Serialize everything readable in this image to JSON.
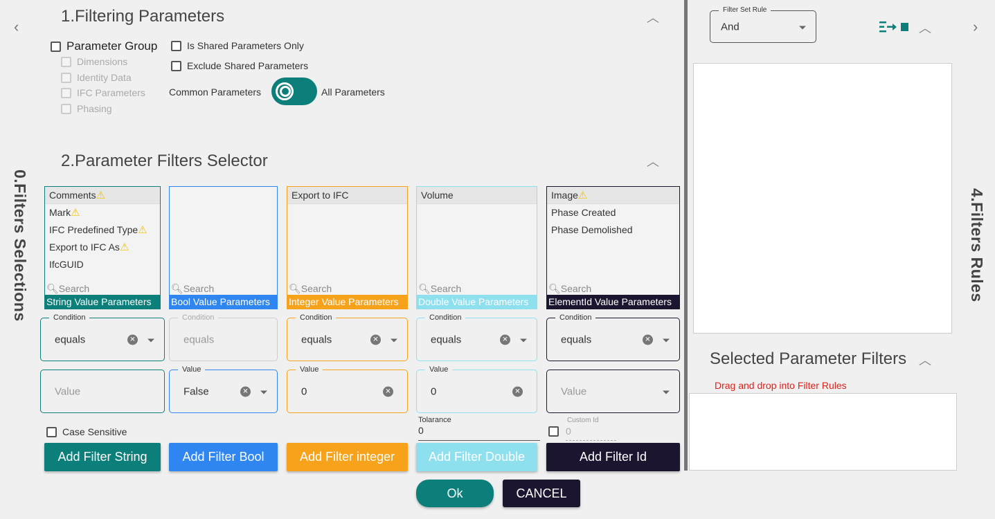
{
  "nav": {
    "left_arrow": "‹",
    "right_arrow": "›"
  },
  "side_labels": {
    "left": "0.Filters Selections",
    "right": "4.Filters Rules"
  },
  "section1": {
    "title": "1.Filtering Parameters",
    "parameter_group": "Parameter Group",
    "groups": [
      "Dimensions",
      "Identity Data",
      "IFC Parameters",
      "Phasing"
    ],
    "shared_only": "Is Shared Parameters Only",
    "exclude_shared": "Exclude Shared Parameters",
    "common": "Common Parameters",
    "all": "All Parameters"
  },
  "section2": {
    "title": "2.Parameter Filters Selector"
  },
  "columns": [
    {
      "items": [
        "Comments",
        "Mark",
        "IFC Predefined Type",
        "Export to IFC As",
        "IfcGUID"
      ],
      "footer": "String Value Parameters",
      "search": "Search",
      "color": "#0d7f7a",
      "condition_label": "Condition",
      "condition": "equals",
      "value_label": "",
      "value": "Value",
      "button": "Add Filter String",
      "extra": "Case Sensitive"
    },
    {
      "items": [],
      "footer": "Bool Value Parameters",
      "search": "Search",
      "color": "#2f86f0",
      "condition_label": "Condition",
      "condition": "equals",
      "value_label": "Value",
      "value": "False",
      "button": "Add Filter Bool"
    },
    {
      "items": [
        "Export to IFC"
      ],
      "footer": "Integer Value Parameters",
      "search": "Search",
      "color": "#f7a21b",
      "condition_label": "Condition",
      "condition": "equals",
      "value_label": "Value",
      "value": "0",
      "button": "Add Filter integer"
    },
    {
      "items": [
        "Volume"
      ],
      "footer": "Double Value Parameters",
      "search": "Search",
      "color": "#8fe0ef",
      "condition_label": "Condition",
      "condition": "equals",
      "value_label": "Value",
      "value": "0",
      "button": "Add Filter Double",
      "extra_label": "Tolarance",
      "extra_value": "0"
    },
    {
      "items": [
        "Image",
        "Phase Created",
        "Phase Demolished"
      ],
      "footer": "ElementId Value Parameters",
      "search": "Search",
      "color": "#1c1530",
      "condition_label": "Condition",
      "condition": "equals",
      "value_label": "",
      "value": "Value",
      "button": "Add Filter Id",
      "extra_label": "Custom Id",
      "extra_value": "0"
    }
  ],
  "right": {
    "filter_set_label": "Filter Set Rule",
    "filter_set_value": "And",
    "selected_title": "Selected Parameter Filters",
    "drag_hint": "Drag and drop into Filter Rules"
  },
  "footer": {
    "ok": "Ok",
    "cancel": "CANCEL"
  }
}
